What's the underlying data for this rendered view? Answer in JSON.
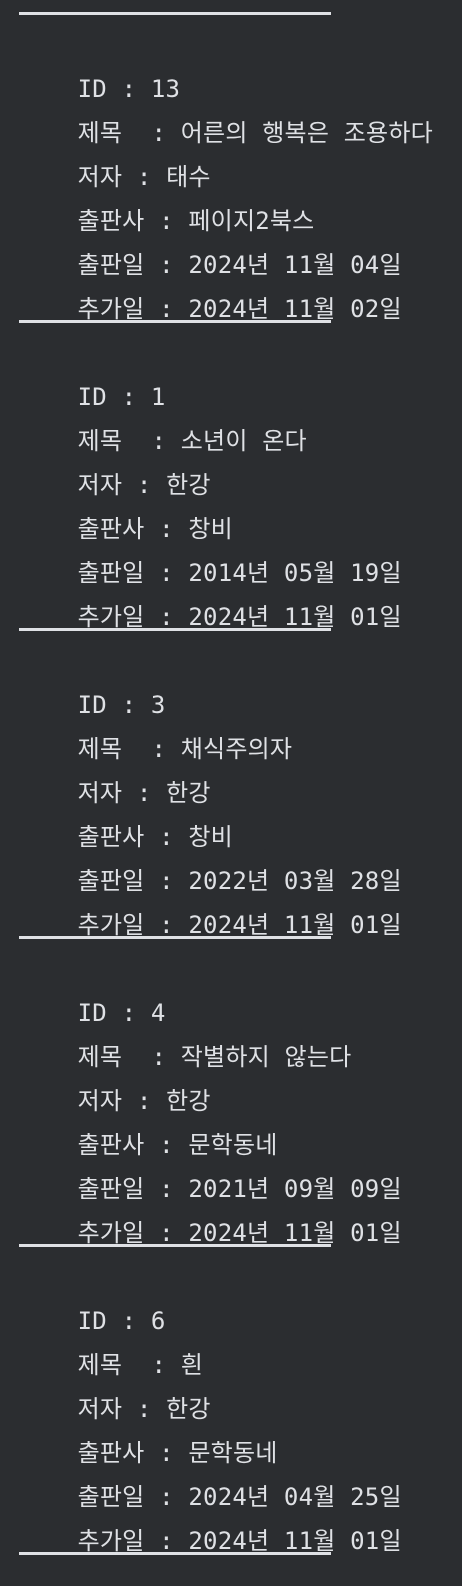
{
  "console": {
    "separator": "—",
    "books": [
      {
        "id": {
          "label": "ID",
          "value": "13"
        },
        "title": {
          "label": "제목",
          "value": "어른의 행복은 조용하다"
        },
        "author": {
          "label": "저자",
          "value": "태수"
        },
        "publisher": {
          "label": "출판사",
          "value": "페이지2북스"
        },
        "published": {
          "label": "출판일",
          "value": "2024년 11월 04일"
        },
        "added": {
          "label": "추가일",
          "value": "2024년 11월 02일"
        }
      },
      {
        "id": {
          "label": "ID",
          "value": "1"
        },
        "title": {
          "label": "제목",
          "value": "소년이 온다"
        },
        "author": {
          "label": "저자",
          "value": "한강"
        },
        "publisher": {
          "label": "출판사",
          "value": "창비"
        },
        "published": {
          "label": "출판일",
          "value": "2014년 05월 19일"
        },
        "added": {
          "label": "추가일",
          "value": "2024년 11월 01일"
        }
      },
      {
        "id": {
          "label": "ID",
          "value": "3"
        },
        "title": {
          "label": "제목",
          "value": "채식주의자"
        },
        "author": {
          "label": "저자",
          "value": "한강"
        },
        "publisher": {
          "label": "출판사",
          "value": "창비"
        },
        "published": {
          "label": "출판일",
          "value": "2022년 03월 28일"
        },
        "added": {
          "label": "추가일",
          "value": "2024년 11월 01일"
        }
      },
      {
        "id": {
          "label": "ID",
          "value": "4"
        },
        "title": {
          "label": "제목",
          "value": "작별하지 않는다"
        },
        "author": {
          "label": "저자",
          "value": "한강"
        },
        "publisher": {
          "label": "출판사",
          "value": "문학동네"
        },
        "published": {
          "label": "출판일",
          "value": "2021년 09월 09일"
        },
        "added": {
          "label": "추가일",
          "value": "2024년 11월 01일"
        }
      },
      {
        "id": {
          "label": "ID",
          "value": "6"
        },
        "title": {
          "label": "제목",
          "value": "흰"
        },
        "author": {
          "label": "저자",
          "value": "한강"
        },
        "publisher": {
          "label": "출판사",
          "value": "문학동네"
        },
        "published": {
          "label": "출판일",
          "value": "2024년 04월 25일"
        },
        "added": {
          "label": "추가일",
          "value": "2024년 11월 01일"
        }
      }
    ]
  },
  "colors": {
    "background": "#2b2d30",
    "text": "#dfe1e5"
  }
}
